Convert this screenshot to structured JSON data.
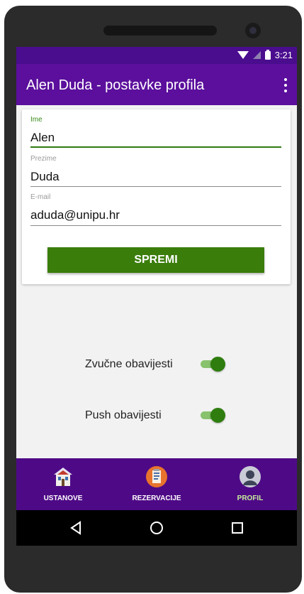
{
  "status": {
    "time": "3:21"
  },
  "appbar": {
    "title": "Alen Duda - postavke profila"
  },
  "form": {
    "first_name": {
      "label": "Ime",
      "value": "Alen"
    },
    "last_name": {
      "label": "Prezime",
      "value": "Duda"
    },
    "email": {
      "label": "E-mail",
      "value": "aduda@unipu.hr"
    },
    "save_label": "SPREMI"
  },
  "toggles": [
    {
      "label": "Zvučne obavijesti",
      "on": true
    },
    {
      "label": "Push obavijesti",
      "on": true
    }
  ],
  "bottom_nav": [
    {
      "label": "USTANOVE",
      "icon": "building-icon",
      "active": false
    },
    {
      "label": "REZERVACIJE",
      "icon": "reservation-icon",
      "active": false
    },
    {
      "label": "PROFIL",
      "icon": "user-icon",
      "active": true
    }
  ],
  "colors": {
    "appbar": "#5b0f9c",
    "accent": "#3a7d0a",
    "nav_bg": "#4e0a86",
    "nav_active": "#c7f09c"
  }
}
